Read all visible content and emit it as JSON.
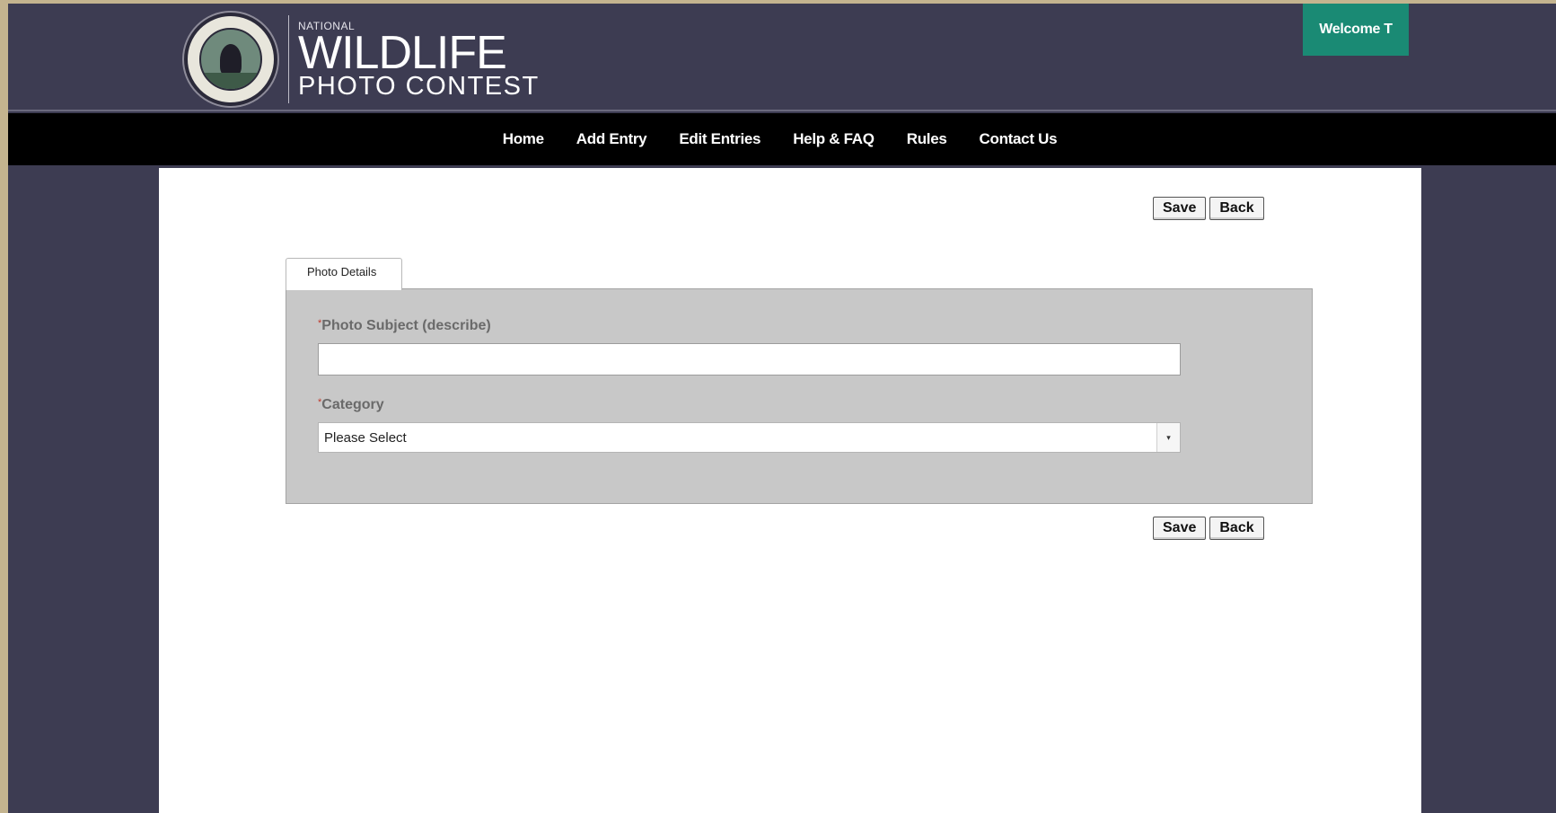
{
  "header": {
    "logo": {
      "national": "NATIONAL",
      "wildlife": "WILDLIFE",
      "photo_contest": "PHOTO CONTEST"
    },
    "welcome": "Welcome T"
  },
  "nav": {
    "items": [
      {
        "label": "Home"
      },
      {
        "label": "Add Entry"
      },
      {
        "label": "Edit Entries"
      },
      {
        "label": "Help & FAQ"
      },
      {
        "label": "Rules"
      },
      {
        "label": "Contact Us"
      }
    ]
  },
  "toolbar": {
    "save_label": "Save",
    "back_label": "Back"
  },
  "form": {
    "tab_label": "Photo Details",
    "required_marker": "*",
    "subject_label": "Photo Subject (describe)",
    "subject_value": "",
    "category_label": "Category",
    "category_selected": "Please Select",
    "select_arrow": "▾"
  },
  "colors": {
    "header_bg": "#3d3c52",
    "nav_bg": "#000000",
    "welcome_bg": "#1a8a74",
    "panel_bg": "#c8c8c8",
    "required": "#c0392b"
  }
}
